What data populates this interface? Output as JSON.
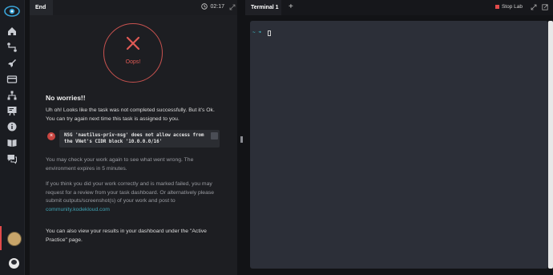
{
  "sidebar": {
    "items": [
      {
        "icon": "home-icon"
      },
      {
        "icon": "route-icon"
      },
      {
        "icon": "rocket-icon"
      },
      {
        "icon": "card-icon"
      },
      {
        "icon": "org-chart-icon"
      },
      {
        "icon": "board-icon"
      },
      {
        "icon": "info-icon"
      },
      {
        "icon": "book-icon"
      },
      {
        "icon": "chat-icon"
      }
    ]
  },
  "left_panel": {
    "tab_label": "End",
    "timer": "02:17",
    "oops_label": "Oops!",
    "heading": "No worries!!",
    "intro": "Uh oh! Looks like the task was not completed successfully. But it's Ok. You can try again next time this task is assigned to you.",
    "error_message": "NSG 'nautilus-priv-nsg' does not allow access from the VNet's CIDR block '10.0.0.0/16'",
    "check_again": "You may check your work again to see what went wrong. The environment expires in 5 minutes.",
    "review_text": "If you think you did your work correctly and is marked failed, you may request for a review from your task dashboard. Or alternatively please submit outputs/screenshot(s) of your work and post to",
    "community_link": "community.kodekloud.com",
    "dashboard_text": "You can also view your results in your dashboard under the \"Active Practice\" page."
  },
  "right_panel": {
    "tab_label": "Terminal 1",
    "add_tab": "+",
    "stop_lab": "Stop Lab",
    "prompt": "~ ➜"
  },
  "colors": {
    "accent_red": "#e24a4a",
    "link": "#3fa3b4",
    "prompt": "#3ecbd6"
  }
}
